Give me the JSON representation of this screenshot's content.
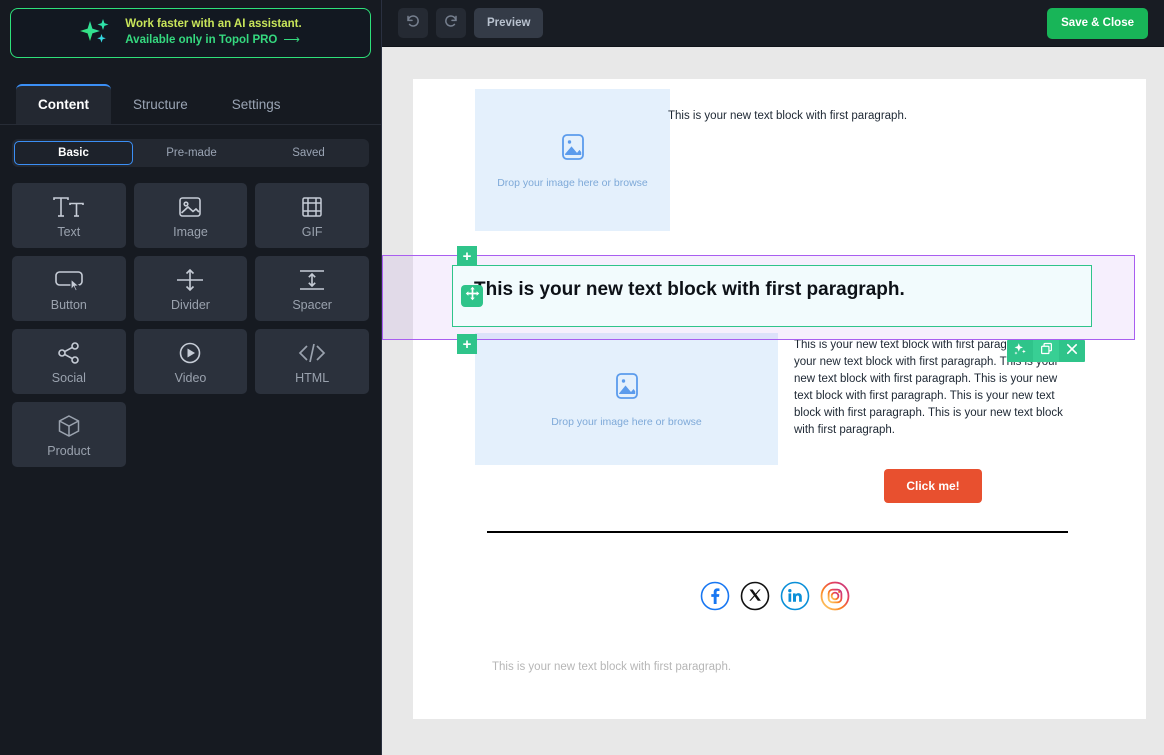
{
  "sidebar": {
    "ai_banner": {
      "icon": "sparkles-icon",
      "line1": "Work faster with an AI assistant.",
      "line2": "Available only in Topol PRO",
      "arrow": "⟶"
    },
    "tabs": [
      {
        "label": "Content",
        "active": true
      },
      {
        "label": "Structure",
        "active": false
      },
      {
        "label": "Settings",
        "active": false
      }
    ],
    "segments": [
      {
        "label": "Basic",
        "active": true
      },
      {
        "label": "Pre-made",
        "active": false
      },
      {
        "label": "Saved",
        "active": false
      }
    ],
    "blocks": [
      {
        "label": "Text",
        "icon": "text-icon"
      },
      {
        "label": "Image",
        "icon": "image-icon"
      },
      {
        "label": "GIF",
        "icon": "gif-icon"
      },
      {
        "label": "Button",
        "icon": "button-icon"
      },
      {
        "label": "Divider",
        "icon": "divider-icon"
      },
      {
        "label": "Spacer",
        "icon": "spacer-icon"
      },
      {
        "label": "Social",
        "icon": "social-share-icon"
      },
      {
        "label": "Video",
        "icon": "video-play-icon"
      },
      {
        "label": "HTML",
        "icon": "code-icon"
      },
      {
        "label": "Product",
        "icon": "cube-icon"
      }
    ]
  },
  "toolbar": {
    "undo_icon": "undo-icon",
    "redo_icon": "redo-icon",
    "preview_label": "Preview",
    "save_label": "Save & Close"
  },
  "canvas": {
    "row1": {
      "image_placeholder": "Drop your image here or browse",
      "text": "This is your new text block with first paragraph."
    },
    "selected_row": {
      "text": "This is your new text block with first paragraph.",
      "plus_label": "+",
      "move_icon": "move-arrows-icon",
      "actions": [
        {
          "icon": "ai-sparkle-icon",
          "name": "ai-assist-button"
        },
        {
          "icon": "duplicate-icon",
          "name": "duplicate-button"
        },
        {
          "icon": "close-icon",
          "name": "delete-button"
        }
      ]
    },
    "row3": {
      "image_placeholder": "Drop your image here or browse",
      "text": "This is your new text block with first paragraph. This is your new text block with first paragraph. This is your new text block with first paragraph. This is your new text block with first paragraph. This is your new text block with first paragraph. This is your new text block with first paragraph.",
      "cta_label": "Click me!"
    },
    "social": [
      {
        "name": "facebook-icon",
        "color": "#1877F2"
      },
      {
        "name": "x-twitter-icon",
        "color": "#000000"
      },
      {
        "name": "linkedin-icon",
        "color": "#0A8FD8"
      },
      {
        "name": "instagram-icon",
        "color": "#E4405F"
      }
    ],
    "footer_text": "This is your new text block with first paragraph."
  },
  "colors": {
    "accent_green": "#2fc48a",
    "selection_purple": "#a95ef0",
    "cta_orange": "#e8502f",
    "save_green": "#18b558",
    "tab_blue": "#3b8ff5"
  }
}
